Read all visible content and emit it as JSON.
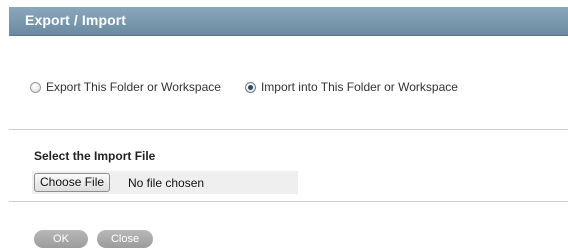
{
  "header": {
    "title": "Export / Import"
  },
  "mode": {
    "options": [
      {
        "label": "Export This Folder or Workspace",
        "checked": false
      },
      {
        "label": "Import into This Folder or Workspace",
        "checked": true
      }
    ]
  },
  "import_file": {
    "label": "Select the Import File",
    "choose_button": "Choose File",
    "status": "No file chosen"
  },
  "actions": {
    "ok": "OK",
    "close": "Close"
  },
  "colors": {
    "header_bar": "#7a97ad",
    "button_gray": "#aaaaaa"
  }
}
